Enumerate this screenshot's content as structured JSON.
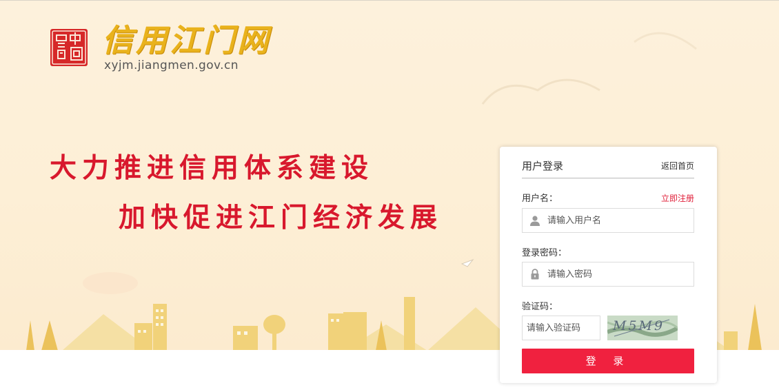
{
  "header": {
    "seal_text": "信中國",
    "site_name": "信用江门网",
    "site_domain": "xyjm.jiangmen.gov.cn"
  },
  "hero": {
    "slogan_1": "大力推进信用体系建设",
    "slogan_2": "加快促进江门经济发展"
  },
  "login": {
    "title": "用户登录",
    "back_home": "返回首页",
    "username_label": "用户名：",
    "register_link": "立即注册",
    "username_placeholder": "请输入用户名",
    "password_label": "登录密码：",
    "password_placeholder": "请输入密码",
    "captcha_label": "验证码：",
    "captcha_placeholder": "请输入验证码",
    "captcha_text": "M5M9",
    "submit_label": "登 录"
  },
  "icons": {
    "user": "user-icon",
    "lock": "lock-icon",
    "seal": "seal-logo"
  },
  "colors": {
    "accent_red": "#f0213f",
    "slogan_red": "#d8182d",
    "logo_gold": "#e9b21c",
    "hero_bg": "#fdf0d8"
  }
}
